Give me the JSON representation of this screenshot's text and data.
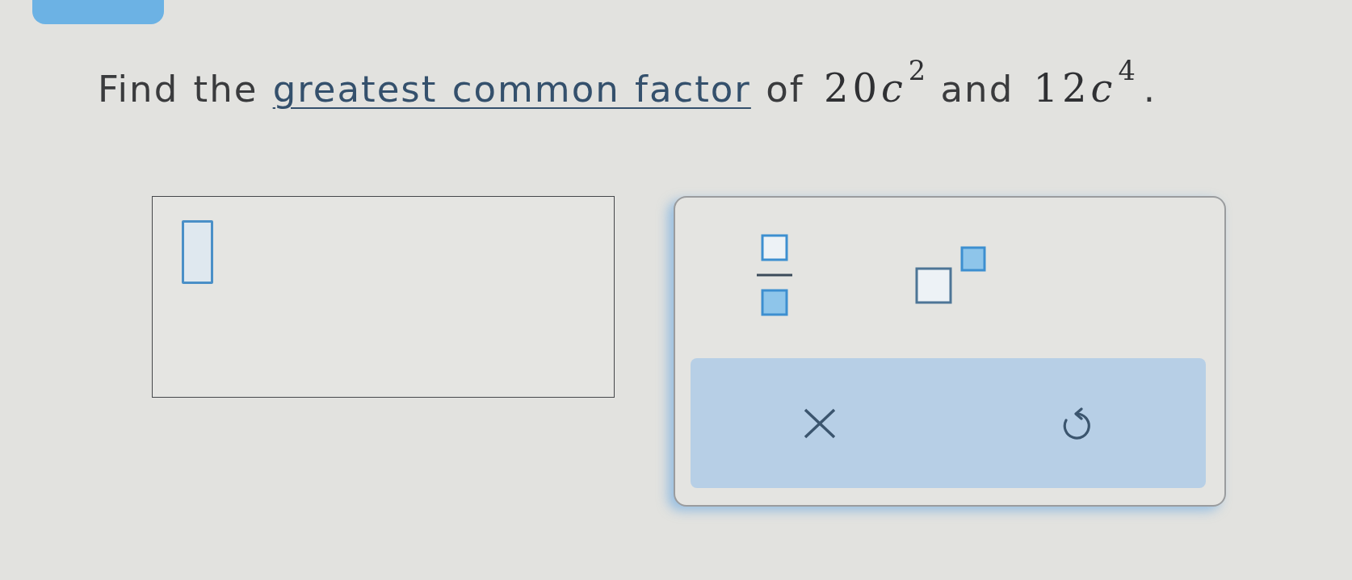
{
  "question": {
    "parts": [
      {
        "kind": "text",
        "text": "Find the"
      },
      {
        "kind": "link",
        "text": "greatest common factor"
      },
      {
        "kind": "text",
        "text": "of"
      },
      {
        "kind": "math",
        "coefficient": "20",
        "variable": "c",
        "exponent": "2"
      },
      {
        "kind": "text",
        "text": "and"
      },
      {
        "kind": "math",
        "coefficient": "12",
        "variable": "c",
        "exponent": "4"
      },
      {
        "kind": "punct",
        "text": "."
      }
    ]
  },
  "toolbar": {
    "tools": [
      {
        "kind": "fraction"
      },
      {
        "kind": "superscript"
      }
    ],
    "actions": [
      {
        "kind": "clear"
      },
      {
        "kind": "undo"
      }
    ]
  }
}
